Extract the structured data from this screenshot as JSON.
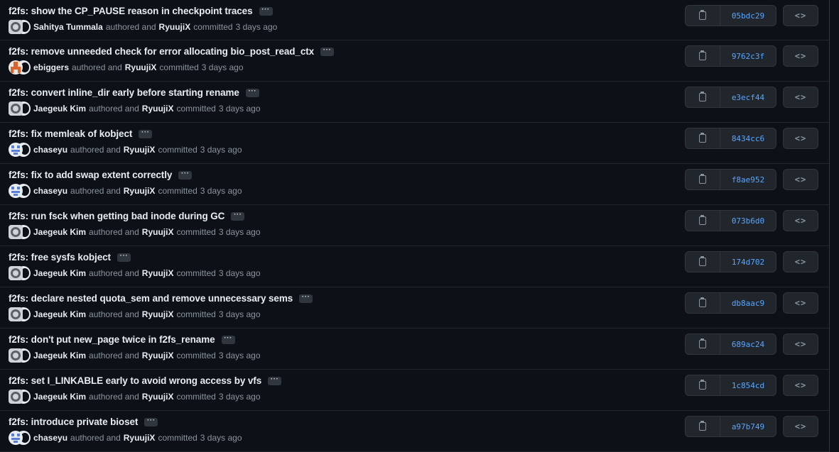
{
  "commits": [
    {
      "title": "f2fs: show the CP_PAUSE reason in checkpoint traces",
      "author": "Sahitya Tummala",
      "avatar": "github-default",
      "committer": "RyuujiX",
      "time": "3 days ago",
      "sha": "05bdc29"
    },
    {
      "title": "f2fs: remove unneeded check for error allocating bio_post_read_ctx",
      "author": "ebiggers",
      "avatar": "ebiggers",
      "committer": "RyuujiX",
      "time": "3 days ago",
      "sha": "9762c3f"
    },
    {
      "title": "f2fs: convert inline_dir early before starting rename",
      "author": "Jaegeuk Kim",
      "avatar": "github-default",
      "committer": "RyuujiX",
      "time": "3 days ago",
      "sha": "e3ecf44"
    },
    {
      "title": "f2fs: fix memleak of kobject",
      "author": "chaseyu",
      "avatar": "chaseyu",
      "committer": "RyuujiX",
      "time": "3 days ago",
      "sha": "8434cc6"
    },
    {
      "title": "f2fs: fix to add swap extent correctly",
      "author": "chaseyu",
      "avatar": "chaseyu",
      "committer": "RyuujiX",
      "time": "3 days ago",
      "sha": "f8ae952"
    },
    {
      "title": "f2fs: run fsck when getting bad inode during GC",
      "author": "Jaegeuk Kim",
      "avatar": "github-default",
      "committer": "RyuujiX",
      "time": "3 days ago",
      "sha": "073b6d0"
    },
    {
      "title": "f2fs: free sysfs kobject",
      "author": "Jaegeuk Kim",
      "avatar": "github-default",
      "committer": "RyuujiX",
      "time": "3 days ago",
      "sha": "174d702"
    },
    {
      "title": "f2fs: declare nested quota_sem and remove unnecessary sems",
      "author": "Jaegeuk Kim",
      "avatar": "github-default",
      "committer": "RyuujiX",
      "time": "3 days ago",
      "sha": "db8aac9"
    },
    {
      "title": "f2fs: don't put new_page twice in f2fs_rename",
      "author": "Jaegeuk Kim",
      "avatar": "github-default",
      "committer": "RyuujiX",
      "time": "3 days ago",
      "sha": "689ac24"
    },
    {
      "title": "f2fs: set I_LINKABLE early to avoid wrong access by vfs",
      "author": "Jaegeuk Kim",
      "avatar": "github-default",
      "committer": "RyuujiX",
      "time": "3 days ago",
      "sha": "1c854cd"
    },
    {
      "title": "f2fs: introduce private bioset",
      "author": "chaseyu",
      "avatar": "chaseyu",
      "committer": "RyuujiX",
      "time": "3 days ago",
      "sha": "a97b749"
    }
  ],
  "labels": {
    "authored": "authored and",
    "committed": "committed",
    "ellipsis": "···",
    "browse": "<>"
  },
  "colors": {
    "background": "#0d1117",
    "sha_link": "#58a6ff",
    "border": "#30363d"
  }
}
